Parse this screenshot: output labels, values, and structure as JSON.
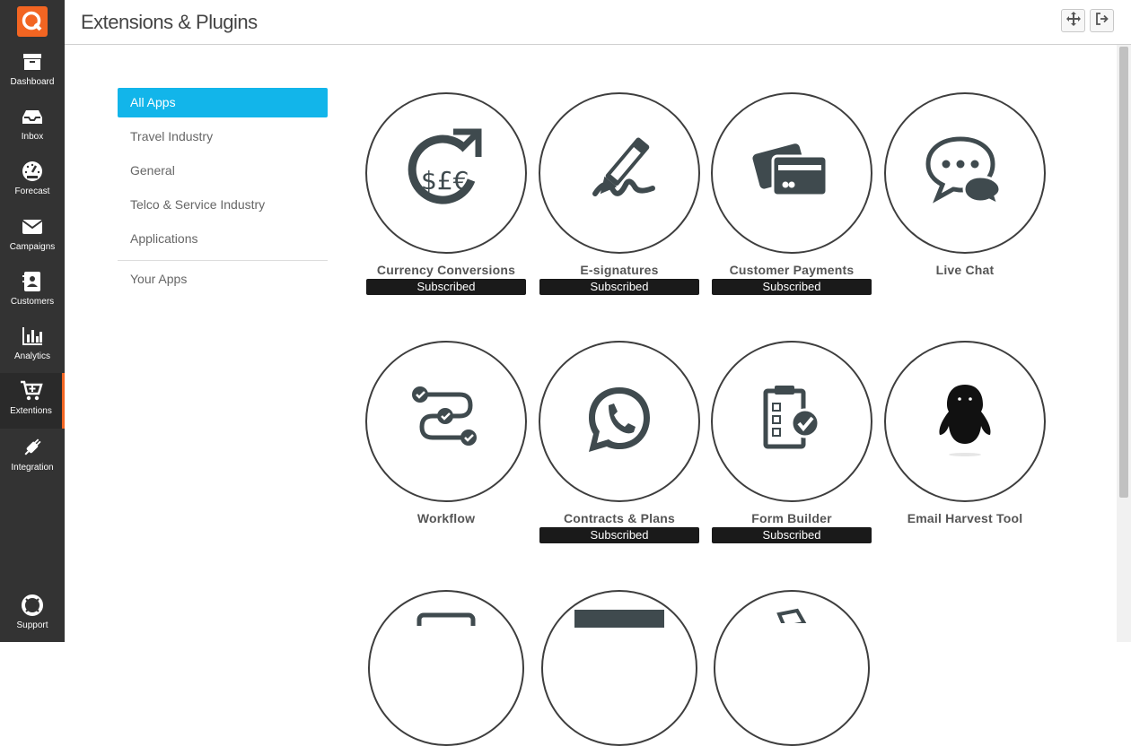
{
  "header": {
    "title": "Extensions & Plugins"
  },
  "sidebar": {
    "items": [
      {
        "label": "Dashboard",
        "icon": "archive-icon"
      },
      {
        "label": "Inbox",
        "icon": "inbox-icon"
      },
      {
        "label": "Forecast",
        "icon": "gauge-icon"
      },
      {
        "label": "Campaigns",
        "icon": "envelope-icon"
      },
      {
        "label": "Customers",
        "icon": "contact-card-icon"
      },
      {
        "label": "Analytics",
        "icon": "bar-chart-icon"
      },
      {
        "label": "Extentions",
        "icon": "cart-plus-icon"
      },
      {
        "label": "Integration",
        "icon": "plug-icon"
      }
    ],
    "support": {
      "label": "Support",
      "icon": "lifebuoy-icon"
    }
  },
  "categories": {
    "all": "All Apps",
    "travel": "Travel Industry",
    "general": "General",
    "telco": "Telco & Service Industry",
    "applications": "Applications",
    "yours": "Your Apps"
  },
  "apps": [
    {
      "name": "Currency Conversions",
      "badge": "Subscribed"
    },
    {
      "name": "E-signatures",
      "badge": "Subscribed"
    },
    {
      "name": "Customer Payments",
      "badge": "Subscribed"
    },
    {
      "name": "Live Chat"
    },
    {
      "name": "Workflow"
    },
    {
      "name": "Contracts & Plans",
      "badge": "Subscribed"
    },
    {
      "name": "Form Builder",
      "badge": "Subscribed"
    },
    {
      "name": "Email Harvest Tool"
    }
  ],
  "colors": {
    "accent": "#12b5ea",
    "brand": "#f26522",
    "sidebar": "#333333",
    "icon": "#3f4a4e"
  }
}
